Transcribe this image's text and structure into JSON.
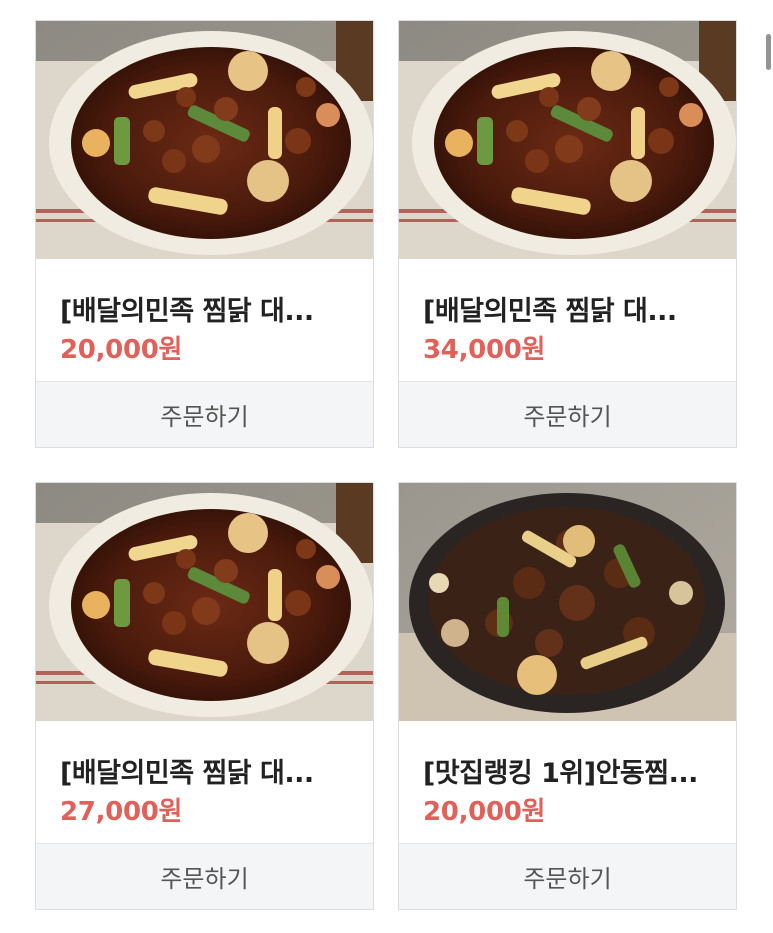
{
  "products": [
    {
      "name": "[배달의민족 찜닭 대...",
      "price": "20,000원",
      "order_label": "주문하기",
      "plate": "white-plate"
    },
    {
      "name": "[배달의민족 찜닭 대...",
      "price": "34,000원",
      "order_label": "주문하기",
      "plate": "white-plate"
    },
    {
      "name": "[배달의민족 찜닭 대...",
      "price": "27,000원",
      "order_label": "주문하기",
      "plate": "white-plate"
    },
    {
      "name": "[맛집랭킹 1위]안동찜...",
      "price": "20,000원",
      "order_label": "주문하기",
      "plate": "dark-plate"
    }
  ],
  "colors": {
    "price": "#e0605a",
    "card_border": "#dcdde0",
    "button_bg": "#f4f5f7",
    "button_text": "#555555",
    "name_text": "#222222"
  }
}
